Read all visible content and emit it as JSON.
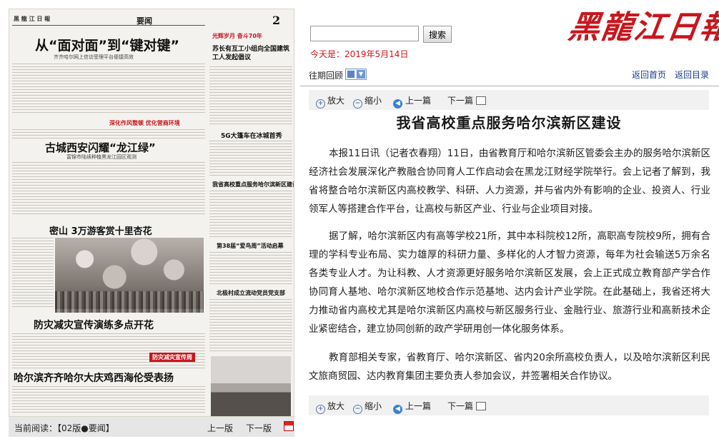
{
  "paper": {
    "masthead": "黑 龍 江 日 報",
    "section": "要闻",
    "page_number": "2",
    "headlines": {
      "h1": "从“面对面”到“键对键”",
      "h1_sub": "齐齐哈尔网上信访受理平台便捷高效",
      "h2": "古城西安闪耀“龙江绿”",
      "h2_sub": "富锦市陆续种植黑龙江园区观测",
      "h3": "密山 3万游客赏十里杏花",
      "h4": "防灾减灾宣传演练多点开花",
      "h5": "哈尔滨齐齐哈尔大庆鸡西海伦受表扬",
      "side1": "苏长有互工小组向全国建筑工人发起倡议",
      "side2": "5G大篷车在冰城首秀",
      "side3": "我省高校重点服务哈尔滨新区建设",
      "side4": "第38届“爱鸟周”活动启幕",
      "side5": "北极村成立流动党员党支部",
      "red_banner1": "深化作风整顿  优化营商环境",
      "red_banner2": "防灾减灾宣传周",
      "red_top": "光辉岁月 奋斗70年"
    }
  },
  "read_bar": {
    "current": "当前阅读：【02版●要闻】",
    "prev_page": "上一版",
    "next_page": "下一版"
  },
  "header": {
    "search_placeholder": "",
    "search_button": "搜索",
    "today": "今天是：2019年5月14日",
    "logo": "黑龍江日報",
    "past_issues": "往期回顾",
    "home_link": "返回首页",
    "dir_link": "返回目录"
  },
  "toolbar": {
    "zoom_in": "放大",
    "zoom_out": "缩小",
    "prev": "上一篇",
    "next": "下一篇"
  },
  "article": {
    "title": "我省高校重点服务哈尔滨新区建设",
    "paragraphs": [
      "本报11日讯（记者衣春翔）11日，由省教育厅和哈尔滨新区管委会主办的服务哈尔滨新区经济社会发展深化产教融合协同育人工作启动会在黑龙江财经学院举行。会上记者了解到，我省将整合哈尔滨新区内高校教学、科研、人力资源，并与省内外有影响的企业、投资人、行业领军人等搭建合作平台，让高校与新区产业、行业与企业项目对接。",
      "据了解，哈尔滨新区内有高等学校21所，其中本科院校12所，高职高专院校9所，拥有合理的学科专业布局、实力雄厚的科研力量、多样化的人才智力资源，每年为社会输送5万余名各类专业人才。为让科教、人才资源更好服务哈尔滨新区发展，会上正式成立教育部产学合作协同育人基地、哈尔滨新区地校合作示范基地、达内会计产业学院。在此基础上，我省还将大力推动省内高校尤其是哈尔滨新区内高校与新区服务行业、金融行业、旅游行业和高新技术企业紧密结合，建立协同创新的政产学研用创一体化服务体系。",
      "教育部相关专家，省教育厅、哈尔滨新区、省内20余所高校负责人，以及哈尔滨新区利民文旅商贸园、达内教育集团主要负责人参加会议，并签署相关合作协议。"
    ]
  }
}
